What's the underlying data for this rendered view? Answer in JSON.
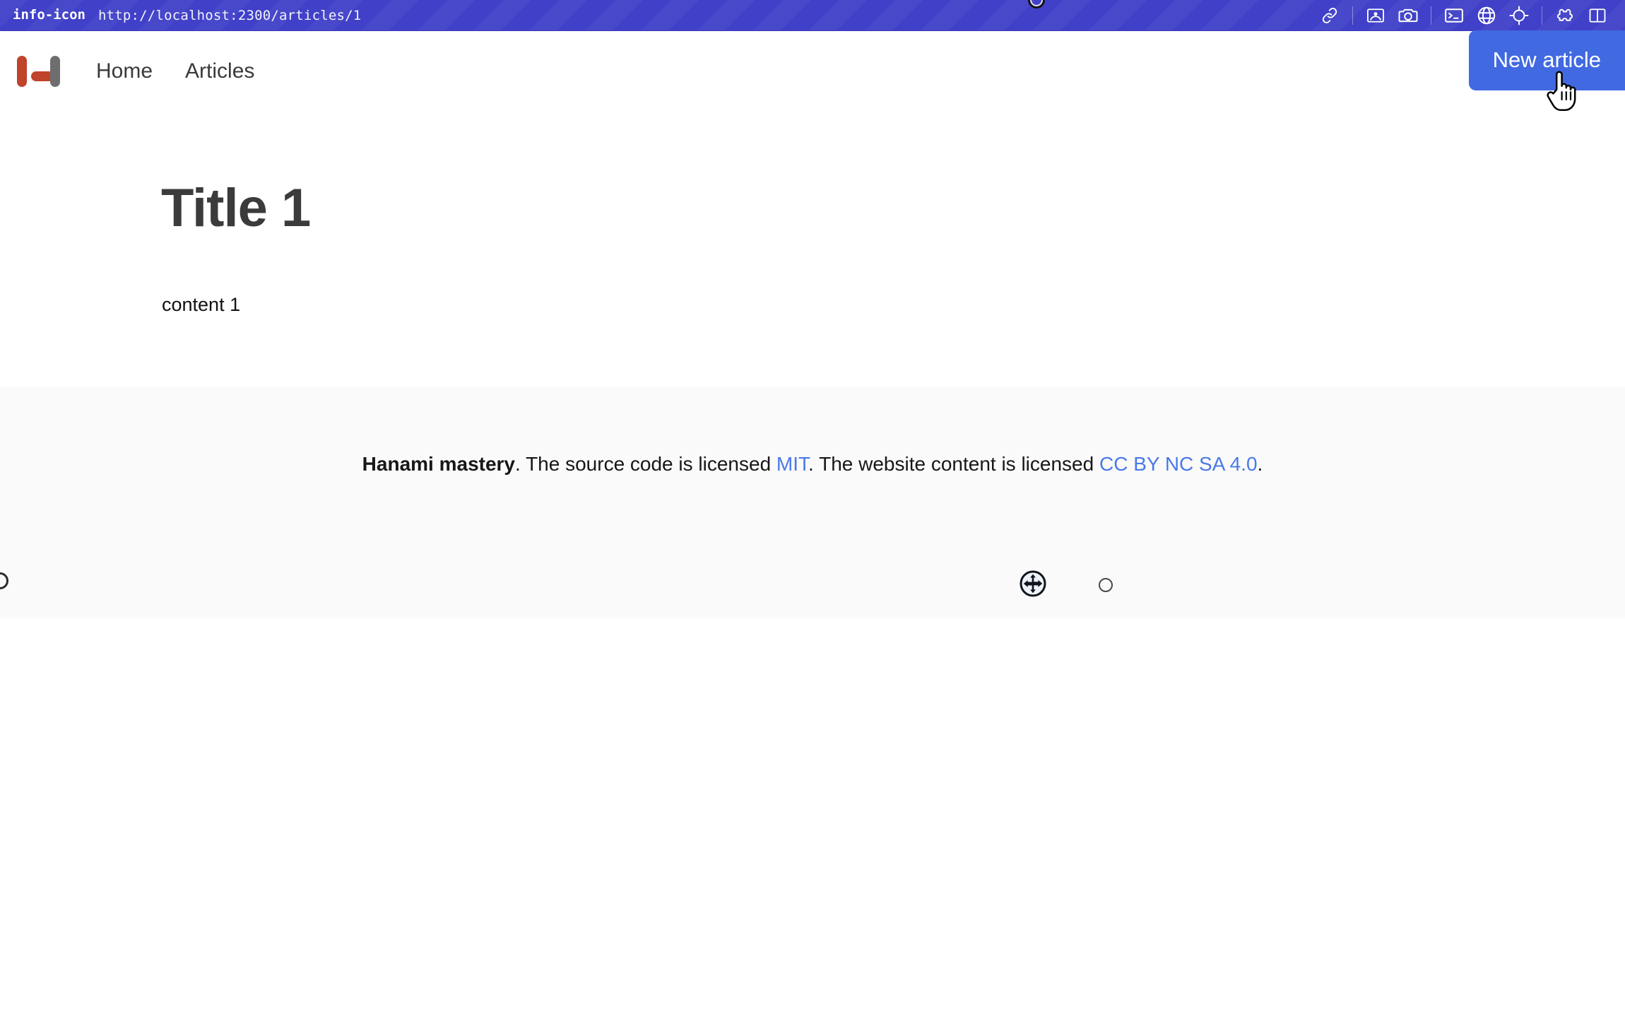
{
  "chrome": {
    "info_icon": "info-icon",
    "url": "http://localhost:2300/articles/1",
    "tools": [
      {
        "name": "link-icon",
        "label": "Link"
      },
      {
        "name": "image-icon",
        "label": "Image"
      },
      {
        "name": "camera-icon",
        "label": "Screenshot"
      },
      {
        "name": "terminal-icon",
        "label": "Terminal"
      },
      {
        "name": "globe-icon",
        "label": "Browser"
      },
      {
        "name": "crosshair-icon",
        "label": "Locate"
      },
      {
        "name": "puzzle-icon",
        "label": "Extensions"
      },
      {
        "name": "split-panel-icon",
        "label": "Split panel"
      }
    ]
  },
  "header": {
    "logo_name": "hanami-logo",
    "nav": [
      {
        "label": "Home"
      },
      {
        "label": "Articles"
      }
    ],
    "new_article_label": "New article"
  },
  "main": {
    "title": "Title 1",
    "content": "content 1"
  },
  "footer": {
    "brand": "Hanami mastery",
    "text_1": ". The source code is licensed ",
    "link_1": "MIT",
    "text_2": ". The website content is licensed ",
    "link_2": "CC BY NC SA 4.0",
    "text_3": "."
  },
  "colors": {
    "chrome_purple": "#4040c8",
    "accent_blue": "#4169e1",
    "link_blue": "#4a79e8",
    "logo_red": "#c0432b",
    "logo_gray": "#6e6e6e",
    "footer_bg": "#fafafa",
    "title_gray": "#3b3b3b"
  }
}
